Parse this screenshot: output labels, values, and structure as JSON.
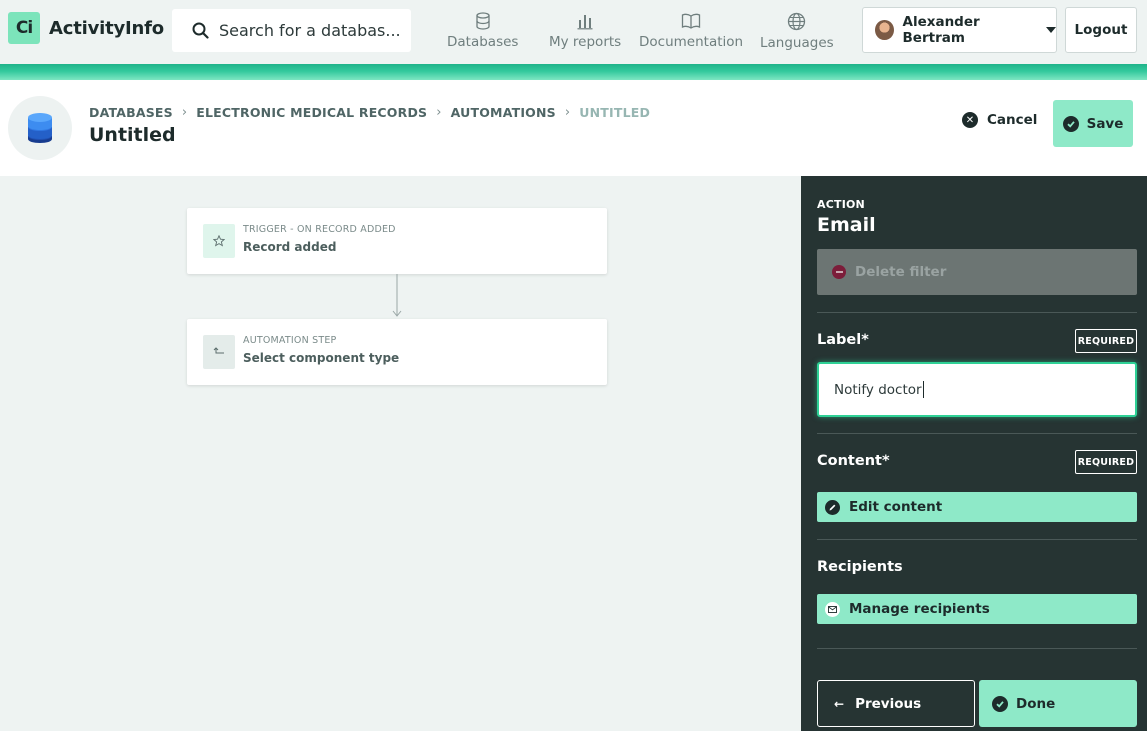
{
  "app": {
    "name": "ActivityInfo",
    "logo_mark": "Ci"
  },
  "search": {
    "placeholder": "Search for a databas..."
  },
  "nav": [
    {
      "label": "Databases",
      "icon": "database-icon"
    },
    {
      "label": "My reports",
      "icon": "bar-chart-icon"
    },
    {
      "label": "Documentation",
      "icon": "book-icon"
    },
    {
      "label": "Languages",
      "icon": "globe-icon"
    }
  ],
  "user": {
    "name": "Alexander Bertram"
  },
  "logout_label": "Logout",
  "breadcrumb": [
    "DATABASES",
    "ELECTRONIC MEDICAL RECORDS",
    "AUTOMATIONS",
    "UNTITLED"
  ],
  "page_title": "Untitled",
  "header_actions": {
    "cancel": "Cancel",
    "save": "Save"
  },
  "flow": {
    "trigger": {
      "kicker": "TRIGGER - ON RECORD ADDED",
      "title": "Record added",
      "icon": "star-icon"
    },
    "step": {
      "kicker": "AUTOMATION STEP",
      "title": "Select component type",
      "icon": "step-icon"
    }
  },
  "panel": {
    "kicker": "ACTION",
    "title": "Email",
    "delete_filter": "Delete filter",
    "label_field": {
      "label": "Label*",
      "badge": "REQUIRED",
      "value": "Notify doctor"
    },
    "content_field": {
      "label": "Content*",
      "badge": "REQUIRED",
      "button": "Edit content"
    },
    "recipients": {
      "label": "Recipients",
      "button": "Manage recipients"
    },
    "previous": "Previous",
    "done": "Done"
  },
  "colors": {
    "accent": "#8ee9c8",
    "panel_bg": "#263433",
    "brand_strip": "#1fb38a",
    "focus_border": "#2fd196",
    "danger": "#7c1d3a"
  }
}
